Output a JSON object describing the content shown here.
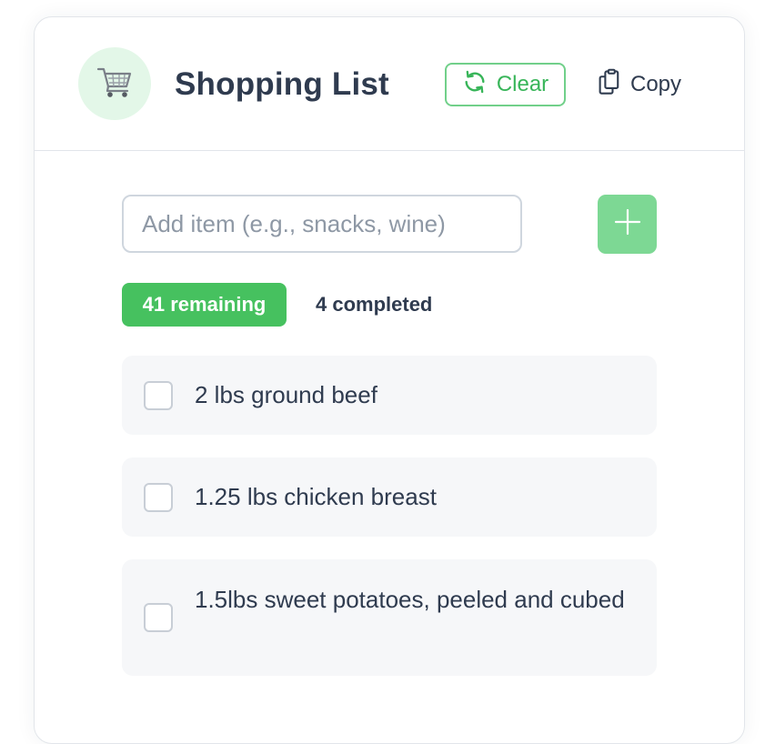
{
  "header": {
    "avatar_icon": "shopping-cart-icon",
    "title": "Shopping List",
    "clear_label": "Clear",
    "copy_label": "Copy"
  },
  "add_item": {
    "placeholder": "Add item (e.g., snacks, wine)",
    "value": ""
  },
  "stats": {
    "remaining": "41 remaining",
    "completed": "4 completed"
  },
  "items": [
    {
      "label": "2 lbs ground beef",
      "checked": false
    },
    {
      "label": "1.25 lbs chicken breast",
      "checked": false
    },
    {
      "label": "1.5lbs sweet potatoes, peeled and cubed",
      "checked": false
    }
  ],
  "colors": {
    "accent": "#46c15f",
    "accent_light": "#7dd894",
    "avatar_bg": "#e3f7e8",
    "text": "#2f3b4f"
  }
}
